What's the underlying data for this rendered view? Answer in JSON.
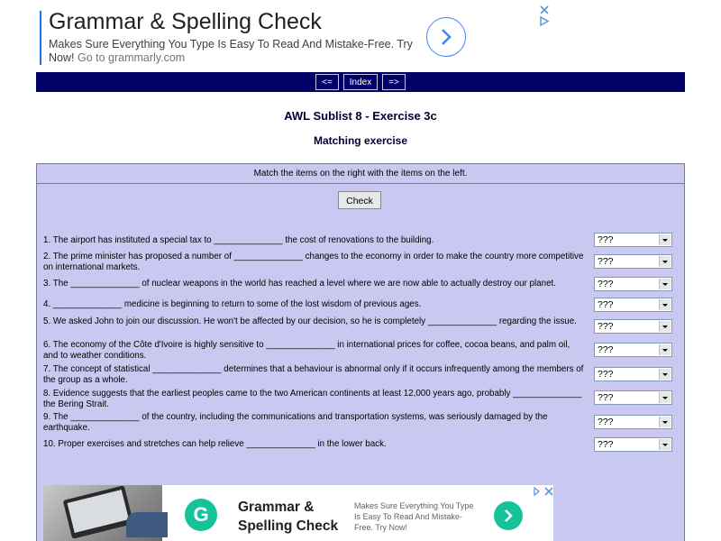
{
  "ad_top": {
    "title": "Grammar & Spelling Check",
    "description": "Makes Sure Everything You Type Is Easy To Read And Mistake-Free. Try Now!",
    "url_text": "Go to grammarly.com"
  },
  "nav": {
    "prev": "<=",
    "index": "Index",
    "next": "=>"
  },
  "header": {
    "title": "AWL Sublist 8 - Exercise 3c",
    "subtitle": "Matching exercise"
  },
  "instructions": "Match the items on the right with the items on the left.",
  "check_label": "Check",
  "questions": [
    {
      "text": "1. The airport has instituted a special tax to ______________ the cost of renovations to the building.",
      "answer": "???"
    },
    {
      "text": "2. The prime minister has proposed a number of ______________ changes to the economy in order to make the country more competitive on international markets.",
      "answer": "???"
    },
    {
      "text": "3. The ______________ of nuclear weapons in the world has reached a level where we are now able to actually destroy our planet.",
      "answer": "???"
    },
    {
      "text": "4. ______________ medicine is beginning to return to some of the lost wisdom of previous ages.",
      "answer": "???"
    },
    {
      "text": "5. We asked John to join our discussion. He won't be affected by our decision, so he is completely ______________ regarding the issue.",
      "answer": "???"
    },
    {
      "text": "6. The economy of the Côte d'Ivoire is highly sensitive to ______________ in international prices for coffee, cocoa beans, and palm oil, and to weather conditions.",
      "answer": "???"
    },
    {
      "text": "7. The concept of statistical ______________ determines that a behaviour is abnormal only if it occurs infrequently among the members of the group as a whole.",
      "answer": "???"
    },
    {
      "text": "8. Evidence suggests that the earliest peoples came to the two American continents at least 12,000 years ago, probably ______________ the Bering Strait.",
      "answer": "???"
    },
    {
      "text": "9. The ______________ of the country, including the communications and transportation systems, was seriously damaged by the earthquake.",
      "answer": "???"
    },
    {
      "text": "10. Proper exercises and stretches can help relieve ______________ in the lower back.",
      "answer": "???"
    }
  ],
  "ad_bottom": {
    "logo_letter": "G",
    "title": "Grammar & Spelling Check",
    "description": "Makes Sure Everything You Type Is Easy To Read And Mistake-Free. Try Now!"
  },
  "colors": {
    "nav_bg": "#000066",
    "panel_bg": "#c8c8f0",
    "ad_accent": "#15c39a",
    "link_blue": "#4285f4"
  },
  "icons": {
    "ad_next": "chevron-right-icon",
    "ad_close": "close-icon",
    "ad_info": "adchoices-icon",
    "select": "dropdown-arrow-icon"
  }
}
